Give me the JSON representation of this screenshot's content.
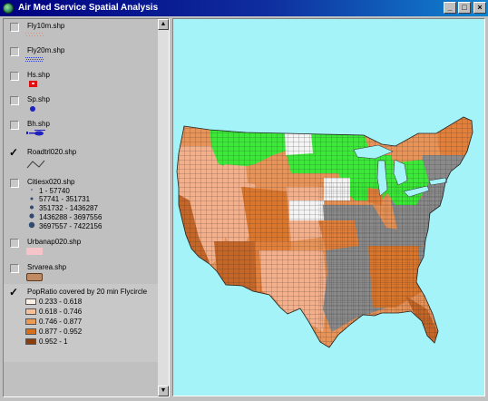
{
  "window": {
    "title": "Air Med Service Spatial Analysis",
    "buttons": {
      "minimize": "_",
      "maximize": "□",
      "close": "×"
    }
  },
  "toc": {
    "layers": [
      {
        "name": "Fly10m.shp",
        "checked": false,
        "symbol": "dotted-line",
        "color": "#d88f7c"
      },
      {
        "name": "Fly20m.shp",
        "checked": false,
        "symbol": "dotted-line",
        "color": "#2f3fd8"
      },
      {
        "name": "Hs.shp",
        "checked": false,
        "symbol": "flag",
        "color": "#e01010"
      },
      {
        "name": "Sp.shp",
        "checked": false,
        "symbol": "dot",
        "color": "#2020c0"
      },
      {
        "name": "Bh.shp",
        "checked": false,
        "symbol": "helicopter",
        "color": "#2020c0"
      },
      {
        "name": "Roadtrl020.shp",
        "checked": true,
        "symbol": "line"
      },
      {
        "name": "Citiesx020.shp",
        "checked": false,
        "classes": [
          "1 - 57740",
          "57741 - 351731",
          "351732 - 1436287",
          "1436288 - 3697556",
          "3697557 - 7422156"
        ]
      },
      {
        "name": "Urbanap020.shp",
        "checked": false,
        "symbol": "fill",
        "color": "#f4c4c8"
      },
      {
        "name": "Srvarea.shp",
        "checked": false,
        "symbol": "fill",
        "color": "#c08a62"
      },
      {
        "name": "PopRatio covered by 20 min Flycircle",
        "checked": true,
        "classes": [
          {
            "label": "0.233 - 0.618",
            "color": "#fcefe4"
          },
          {
            "label": "0.618 - 0.746",
            "color": "#f5c09a"
          },
          {
            "label": "0.746 - 0.877",
            "color": "#ec9a52"
          },
          {
            "label": "0.877 - 0.952",
            "color": "#d6701c"
          },
          {
            "label": "0.952 - 1",
            "color": "#8a3e0c"
          }
        ]
      }
    ]
  },
  "map": {
    "background": "#a4f3f8",
    "legend_colors": {
      "green": "#3de83a",
      "white": "#f4f4f4",
      "light_salmon": "#f3b08c",
      "orange": "#e0803c",
      "gray": "#8a8a8a",
      "dark_orange": "#c2662a"
    }
  }
}
